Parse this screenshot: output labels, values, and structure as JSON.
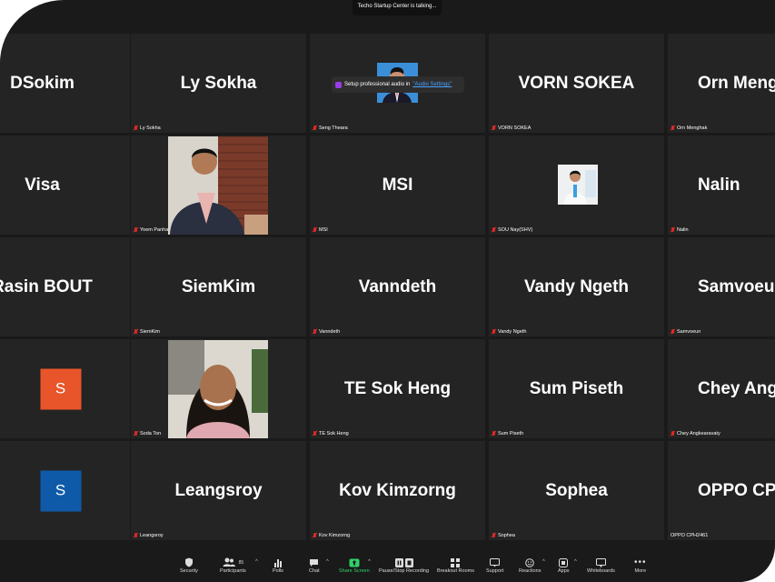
{
  "talking_banner": "Techo Startup Center is talking...",
  "toast": {
    "text": "Setup professional audio in ",
    "link": "\"Audio Settings\""
  },
  "tiles": [
    {
      "row": 0,
      "col": 0,
      "name": "DSokim",
      "label": "",
      "kind": "name"
    },
    {
      "row": 0,
      "col": 1,
      "name": "Ly Sokha",
      "label": "Ly Sokha",
      "kind": "name"
    },
    {
      "row": 0,
      "col": 2,
      "name": "",
      "label": "Seng Theara",
      "kind": "photo-man-small"
    },
    {
      "row": 0,
      "col": 3,
      "name": "VORN SOKEA",
      "label": "VORN SOKEA",
      "kind": "name"
    },
    {
      "row": 0,
      "col": 4,
      "name": "Orn Menghak",
      "label": "Orn Menghak",
      "kind": "name"
    },
    {
      "row": 1,
      "col": 0,
      "name": "Visa",
      "label": "",
      "kind": "name"
    },
    {
      "row": 1,
      "col": 1,
      "name": "",
      "label": "Yoem Panha",
      "kind": "photo-man-suit"
    },
    {
      "row": 1,
      "col": 2,
      "name": "MSI",
      "label": "MSI",
      "kind": "name"
    },
    {
      "row": 1,
      "col": 3,
      "name": "",
      "label": "SOU Nay(SHV)",
      "kind": "photo-man-tiny"
    },
    {
      "row": 1,
      "col": 4,
      "name": "Nalin",
      "label": "Nalin",
      "kind": "name"
    },
    {
      "row": 2,
      "col": 0,
      "name": "Rasin BOUT",
      "label": "",
      "kind": "name"
    },
    {
      "row": 2,
      "col": 1,
      "name": "SiemKim",
      "label": "SiemKim",
      "kind": "name"
    },
    {
      "row": 2,
      "col": 2,
      "name": "Vanndeth",
      "label": "Vanndeth",
      "kind": "name"
    },
    {
      "row": 2,
      "col": 3,
      "name": "Vandy Ngeth",
      "label": "Vandy Ngeth",
      "kind": "name"
    },
    {
      "row": 2,
      "col": 4,
      "name": "Samvoeun",
      "label": "Samvoeun",
      "kind": "name"
    },
    {
      "row": 3,
      "col": 0,
      "name": "S",
      "label": "",
      "kind": "avatar",
      "color": "#e8552a"
    },
    {
      "row": 3,
      "col": 1,
      "name": "",
      "label": "Soda Ton",
      "kind": "photo-woman"
    },
    {
      "row": 3,
      "col": 2,
      "name": "TE Sok Heng",
      "label": "TE Sok Heng",
      "kind": "name"
    },
    {
      "row": 3,
      "col": 3,
      "name": "Sum Piseth",
      "label": "Sum Piseth",
      "kind": "name"
    },
    {
      "row": 3,
      "col": 4,
      "name": "Chey  Angkearavaty",
      "label": "Chey Angkearavaty",
      "kind": "name"
    },
    {
      "row": 4,
      "col": 0,
      "name": "S",
      "label": "",
      "kind": "avatar",
      "color": "#0f5aa8"
    },
    {
      "row": 4,
      "col": 1,
      "name": "Leangsroy",
      "label": "Leangsroy",
      "kind": "name"
    },
    {
      "row": 4,
      "col": 2,
      "name": "Kov Kimzorng",
      "label": "Kov Kimzorng",
      "kind": "name"
    },
    {
      "row": 4,
      "col": 3,
      "name": "Sophea",
      "label": "Sophea",
      "kind": "name"
    },
    {
      "row": 4,
      "col": 4,
      "name": "OPPO CPH2461",
      "label": "OPPO CPH2461",
      "kind": "name"
    }
  ],
  "toolbar": {
    "security": "Security",
    "participants": "Participants",
    "participants_count": "85",
    "polls": "Polls",
    "chat": "Chat",
    "share_screen": "Share Screen",
    "recording": "Pause/Stop Recording",
    "breakout": "Breakout Rooms",
    "support": "Support",
    "reactions": "Reactions",
    "apps": "Apps",
    "whiteboards": "Whiteboards",
    "more": "More"
  },
  "colors": {
    "tile_bg": "#242424",
    "screen_bg": "#1a1a1a",
    "share_green": "#2fd36a",
    "muted_red": "#e02828"
  }
}
